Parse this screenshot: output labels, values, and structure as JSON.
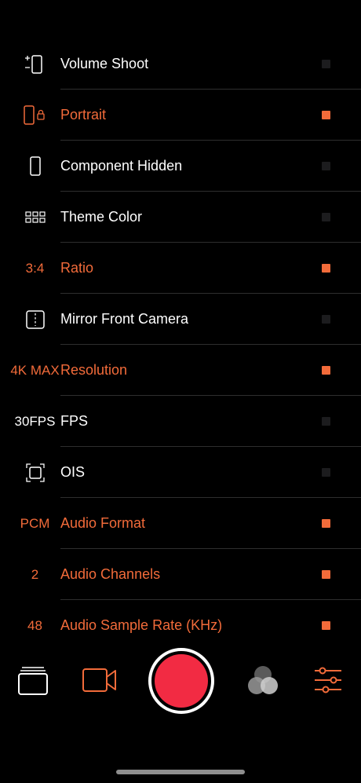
{
  "colors": {
    "accent": "#f26b3a",
    "record": "#f22b43",
    "text": "#ffffff",
    "background": "#000000"
  },
  "settings": [
    {
      "icon": "volume-buttons-icon",
      "icon_text": "",
      "label": "Volume Shoot",
      "enabled": false
    },
    {
      "icon": "portrait-lock-icon",
      "icon_text": "",
      "label": "Portrait",
      "enabled": true
    },
    {
      "icon": "phone-icon",
      "icon_text": "",
      "label": "Component Hidden",
      "enabled": false
    },
    {
      "icon": "grid-icon",
      "icon_text": "",
      "label": "Theme Color",
      "enabled": false
    },
    {
      "icon": "",
      "icon_text": "3:4",
      "label": "Ratio",
      "enabled": true
    },
    {
      "icon": "mirror-icon",
      "icon_text": "",
      "label": "Mirror Front Camera",
      "enabled": false
    },
    {
      "icon": "",
      "icon_text": "4K MAX",
      "label": "Resolution",
      "enabled": true
    },
    {
      "icon": "",
      "icon_text": "30FPS",
      "label": "FPS",
      "enabled": false
    },
    {
      "icon": "stabilization-icon",
      "icon_text": "",
      "label": "OIS",
      "enabled": false
    },
    {
      "icon": "",
      "icon_text": "PCM",
      "label": "Audio Format",
      "enabled": true
    },
    {
      "icon": "",
      "icon_text": "2",
      "label": "Audio Channels",
      "enabled": true
    },
    {
      "icon": "",
      "icon_text": "48",
      "label": "Audio Sample Rate (KHz)",
      "enabled": true
    }
  ],
  "toolbar": {
    "items": [
      "gallery-stack-icon",
      "video-camera-icon",
      "record-button",
      "color-filters-icon",
      "settings-sliders-icon"
    ]
  }
}
